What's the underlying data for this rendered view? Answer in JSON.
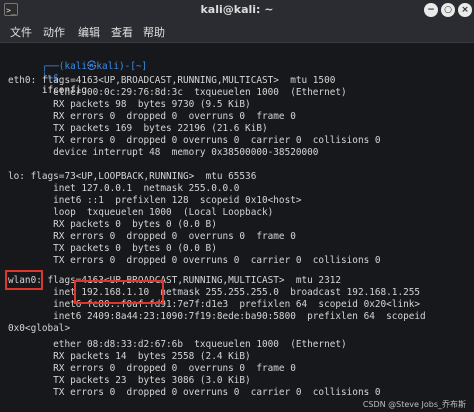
{
  "window": {
    "title": "kali@kali: ~",
    "app_icon": ">_",
    "minimize": "−",
    "maximize": "○",
    "close": "×"
  },
  "menu": [
    "文件",
    "动作",
    "编辑",
    "查看",
    "帮助"
  ],
  "terminal": {
    "prompt_top": "┌──(kali㉿kali)-[~]",
    "prompt_bottom_marker": "└─$",
    "command": "ifconfig",
    "lines": [
      "eth0: flags=4163<UP,BROADCAST,RUNNING,MULTICAST>  mtu 1500",
      "        ether 00:0c:29:76:8d:3c  txqueuelen 1000  (Ethernet)",
      "        RX packets 98  bytes 9730 (9.5 KiB)",
      "        RX errors 0  dropped 0  overruns 0  frame 0",
      "        TX packets 169  bytes 22196 (21.6 KiB)",
      "        TX errors 0  dropped 0 overruns 0  carrier 0  collisions 0",
      "        device interrupt 48  memory 0x38500000-38520000",
      "",
      "lo: flags=73<UP,LOOPBACK,RUNNING>  mtu 65536",
      "        inet 127.0.0.1  netmask 255.0.0.0",
      "        inet6 ::1  prefixlen 128  scopeid 0x10<host>",
      "        loop  txqueuelen 1000  (Local Loopback)",
      "        RX packets 0  bytes 0 (0.0 B)",
      "        RX errors 0  dropped 0  overruns 0  frame 0",
      "        TX packets 0  bytes 0 (0.0 B)",
      "        TX errors 0  dropped 0 overruns 0  carrier 0  collisions 0",
      "",
      "wlan0: flags=4163<UP,BROADCAST,RUNNING,MULTICAST>  mtu 2312",
      "        inet 192.168.1.10  netmask 255.255.255.0  broadcast 192.168.1.255",
      "        inet6 fe80::f0af:fd91:7e7f:d1e3  prefixlen 64  scopeid 0x20<link>",
      "        inet6 2409:8a44:23:1090:7f19:8ede:ba90:5800  prefixlen 64  scopeid",
      "0x0<global>",
      "        ether 08:d8:33:d2:67:6b  txqueuelen 1000  (Ethernet)",
      "        RX packets 14  bytes 2558 (2.4 KiB)",
      "        RX errors 0  dropped 0  overruns 0  frame 0",
      "        TX packets 23  bytes 3086 (3.0 KiB)",
      "        TX errors 0  dropped 0 overruns 0  carrier 0  collisions 0"
    ]
  },
  "watermark": "CSDN @Steve Jobs_乔布斯",
  "colors": {
    "background": "#17181c",
    "titlebar": "#2b2c31",
    "text": "#d4d4d4",
    "prompt": "#3b8eea",
    "highlight": "#e0352b"
  }
}
